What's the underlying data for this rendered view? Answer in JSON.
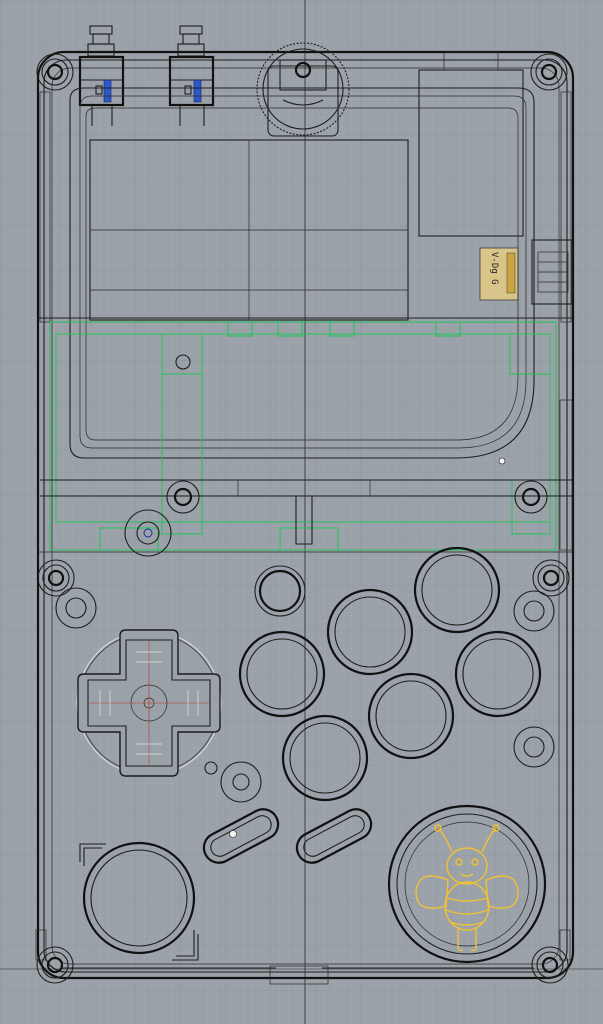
{
  "viewport": {
    "grid_minor_color": "#a8aeb4",
    "grid_major_color": "#8e959c",
    "background": "#9aa1a8"
  },
  "outline_color": "#1e1e1e",
  "pcb_outline_color": "#21c35a",
  "logo_color": "#f1c232",
  "switch_color": "#2d58c9",
  "connector_label": "V-Dg G"
}
